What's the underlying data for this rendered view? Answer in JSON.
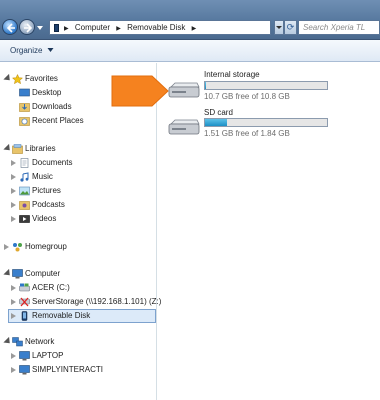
{
  "address_bar": {
    "crumbs": [
      "Computer",
      "Removable Disk"
    ],
    "search_placeholder": "Search Xperia TL"
  },
  "toolbar": {
    "organize_label": "Organize"
  },
  "nav": {
    "favorites": {
      "label": "Favorites",
      "items": [
        "Desktop",
        "Downloads",
        "Recent Places"
      ]
    },
    "libraries": {
      "label": "Libraries",
      "items": [
        "Documents",
        "Music",
        "Pictures",
        "Podcasts",
        "Videos"
      ]
    },
    "homegroup": {
      "label": "Homegroup"
    },
    "computer": {
      "label": "Computer",
      "items": [
        "ACER (C:)",
        "ServerStorage (\\\\192.168.1.101) (Z:)",
        "Removable Disk"
      ]
    },
    "network": {
      "label": "Network",
      "items": [
        "LAPTOP",
        "SIMPLYINTERACTI"
      ]
    }
  },
  "content": {
    "drives": [
      {
        "name": "Internal storage",
        "free_text": "10.7 GB free of 10.8 GB",
        "used_fraction": 0.01
      },
      {
        "name": "SD card",
        "free_text": "1.51 GB free of 1.84 GB",
        "used_fraction": 0.18
      }
    ]
  },
  "colors": {
    "callout_arrow": "#f5821f",
    "accent": "#2e78c8"
  }
}
